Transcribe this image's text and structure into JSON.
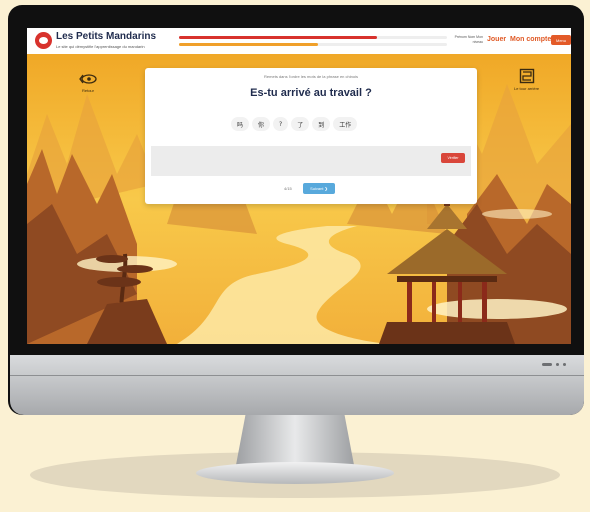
{
  "header": {
    "brand_title": "Les Petits Mandarins",
    "brand_subtitle": "Le site qui démystifie l'apprentissage du mandarin",
    "user_text": "Prénom Nom\nMon niveau",
    "nav_play": "Jouer",
    "nav_account": "Mon compte",
    "menu_label": "Menu",
    "progress_1": 0.74,
    "progress_2": 0.52
  },
  "side": {
    "back_label": "Retour",
    "board_label": "Le tour arrière"
  },
  "exercise": {
    "instruction": "Remets dans l'ordre les mots de la phrase en chinois",
    "question": "Es-tu arrivé au travail ?",
    "chips": [
      "吗",
      "你",
      "?",
      "了",
      "到",
      "工作"
    ],
    "check_label": "Vérifier",
    "progress_count": "4/15",
    "next_label": "Suivant ❯"
  },
  "colors": {
    "accent_red": "#d8322d",
    "accent_orange": "#e05a26",
    "button_blue": "#58a9dc",
    "sky_yellow": "#f3b52b"
  }
}
